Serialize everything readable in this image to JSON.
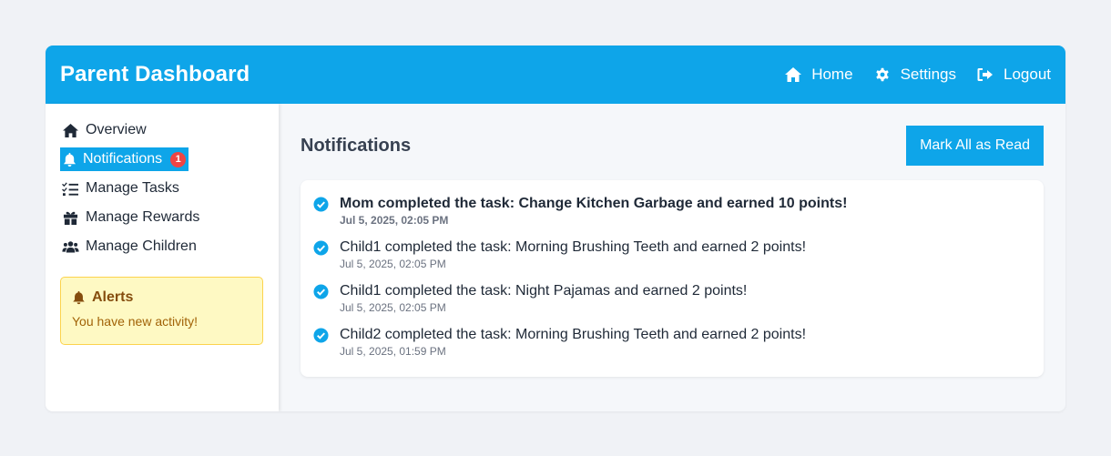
{
  "header": {
    "title": "Parent Dashboard",
    "nav": {
      "home_label": "Home",
      "settings_label": "Settings",
      "logout_label": "Logout"
    }
  },
  "sidebar": {
    "items": [
      {
        "label": "Overview",
        "icon": "home-icon"
      },
      {
        "label": "Notifications",
        "icon": "bell-icon",
        "badge": "1",
        "active": true
      },
      {
        "label": "Manage Tasks",
        "icon": "task-list-icon"
      },
      {
        "label": "Manage Rewards",
        "icon": "gift-icon"
      },
      {
        "label": "Manage Children",
        "icon": "users-icon"
      }
    ],
    "alerts": {
      "title": "Alerts",
      "text": "You have new activity!"
    }
  },
  "main": {
    "heading": "Notifications",
    "mark_all_label": "Mark All as Read",
    "notifications": [
      {
        "message": "Mom completed the task: Change Kitchen Garbage and earned 10 points!",
        "time": "Jul 5, 2025, 02:05 PM",
        "unread": true
      },
      {
        "message": "Child1 completed the task: Morning Brushing Teeth and earned 2 points!",
        "time": "Jul 5, 2025, 02:05 PM",
        "unread": false
      },
      {
        "message": "Child1 completed the task: Night Pajamas and earned 2 points!",
        "time": "Jul 5, 2025, 02:05 PM",
        "unread": false
      },
      {
        "message": "Child2 completed the task: Morning Brushing Teeth and earned 2 points!",
        "time": "Jul 5, 2025, 01:59 PM",
        "unread": false
      }
    ]
  },
  "colors": {
    "accent": "#0ea5e9",
    "badge": "#ef4444",
    "alert_bg": "#fef9c3",
    "alert_text": "#854d0e"
  }
}
